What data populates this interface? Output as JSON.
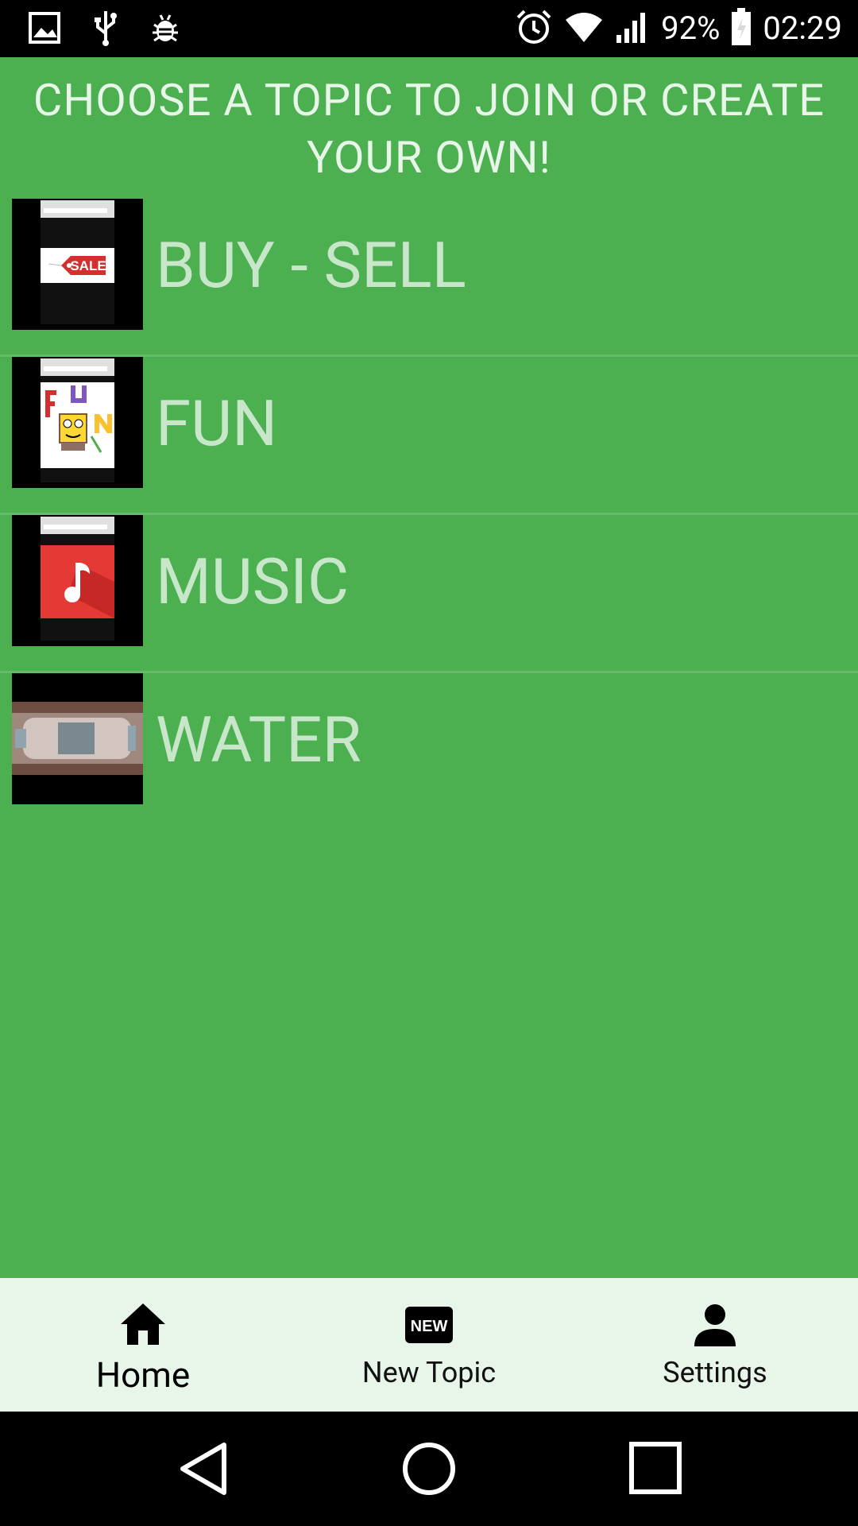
{
  "status_bar": {
    "battery": "92%",
    "time": "02:29",
    "left_icons": [
      "gallery-icon",
      "usb-icon",
      "bug-icon"
    ],
    "right_icons": [
      "alarm-icon",
      "wifi-icon",
      "signal-icon",
      "battery-icon"
    ]
  },
  "header": {
    "title": "CHOOSE A TOPIC TO JOIN OR CREATE YOUR OWN!"
  },
  "topics": [
    {
      "label": "BUY - SELL",
      "thumb": "sale-tag-thumbnail",
      "thumb_text": "SALE"
    },
    {
      "label": "FUN",
      "thumb": "fun-cartoon-thumbnail"
    },
    {
      "label": "MUSIC",
      "thumb": "music-note-thumbnail"
    },
    {
      "label": "WATER",
      "thumb": "water-bottle-thumbnail"
    }
  ],
  "bottom_nav": {
    "items": [
      {
        "label": "Home",
        "icon": "home-icon",
        "active": true
      },
      {
        "label": "New Topic",
        "icon": "new-badge-icon",
        "icon_text": "NEW",
        "active": false
      },
      {
        "label": "Settings",
        "icon": "person-icon",
        "active": false
      }
    ]
  },
  "colors": {
    "background": "#4caf50",
    "topic_text": "#c8e6c9",
    "nav_background": "#e8f5e9",
    "divider": "#66bb6a"
  },
  "system_nav": [
    "back-icon",
    "home-circle-icon",
    "recents-icon"
  ]
}
